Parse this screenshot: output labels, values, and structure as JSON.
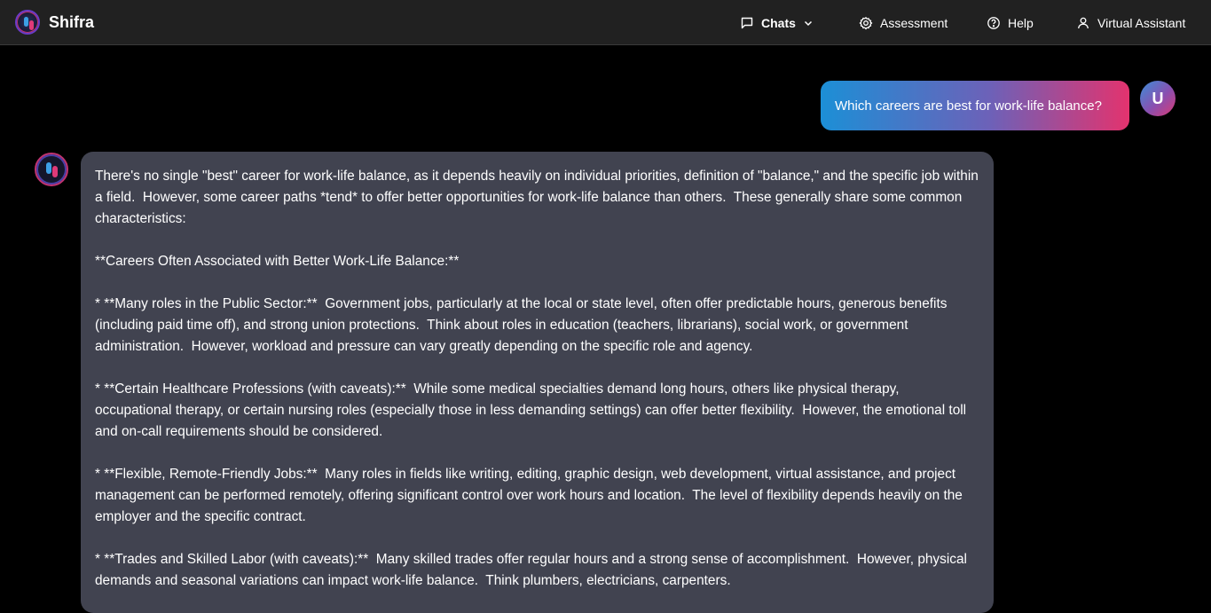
{
  "header": {
    "brand": "Shifra",
    "nav": {
      "chats": "Chats",
      "assessment": "Assessment",
      "help": "Help",
      "virtual_assistant": "Virtual Assistant"
    }
  },
  "conversation": {
    "user_message": "Which careers are best for work-life balance?",
    "user_avatar_letter": "U",
    "bot_paragraphs": [
      "There's no single \"best\" career for work-life balance, as it depends heavily on individual priorities, definition of \"balance,\" and the specific job within a field.  However, some career paths *tend* to offer better opportunities for work-life balance than others.  These generally share some common characteristics:",
      "**Careers Often Associated with Better Work-Life Balance:**",
      "* **Many roles in the Public Sector:**  Government jobs, particularly at the local or state level, often offer predictable hours, generous benefits (including paid time off), and strong union protections.  Think about roles in education (teachers, librarians), social work, or government administration.  However, workload and pressure can vary greatly depending on the specific role and agency.",
      "* **Certain Healthcare Professions (with caveats):**  While some medical specialties demand long hours, others like physical therapy, occupational therapy, or certain nursing roles (especially those in less demanding settings) can offer better flexibility.  However, the emotional toll and on-call requirements should be considered.",
      "* **Flexible, Remote-Friendly Jobs:**  Many roles in fields like writing, editing, graphic design, web development, virtual assistance, and project management can be performed remotely, offering significant control over work hours and location.  The level of flexibility depends heavily on the employer and the specific contract.",
      "* **Trades and Skilled Labor (with caveats):**  Many skilled trades offer regular hours and a strong sense of accomplishment.  However, physical demands and seasonal variations can impact work-life balance.  Think plumbers, electricians, carpenters."
    ]
  },
  "colors": {
    "topbar": "#212121",
    "background": "#000000",
    "bot_bubble": "#414350",
    "gradient_start": "#1c8fd6",
    "gradient_end": "#e3336e"
  },
  "icons": [
    "shifra-logo-icon",
    "chat-icon",
    "chevron-down-icon",
    "gear-icon",
    "help-circle-icon",
    "user-icon"
  ]
}
